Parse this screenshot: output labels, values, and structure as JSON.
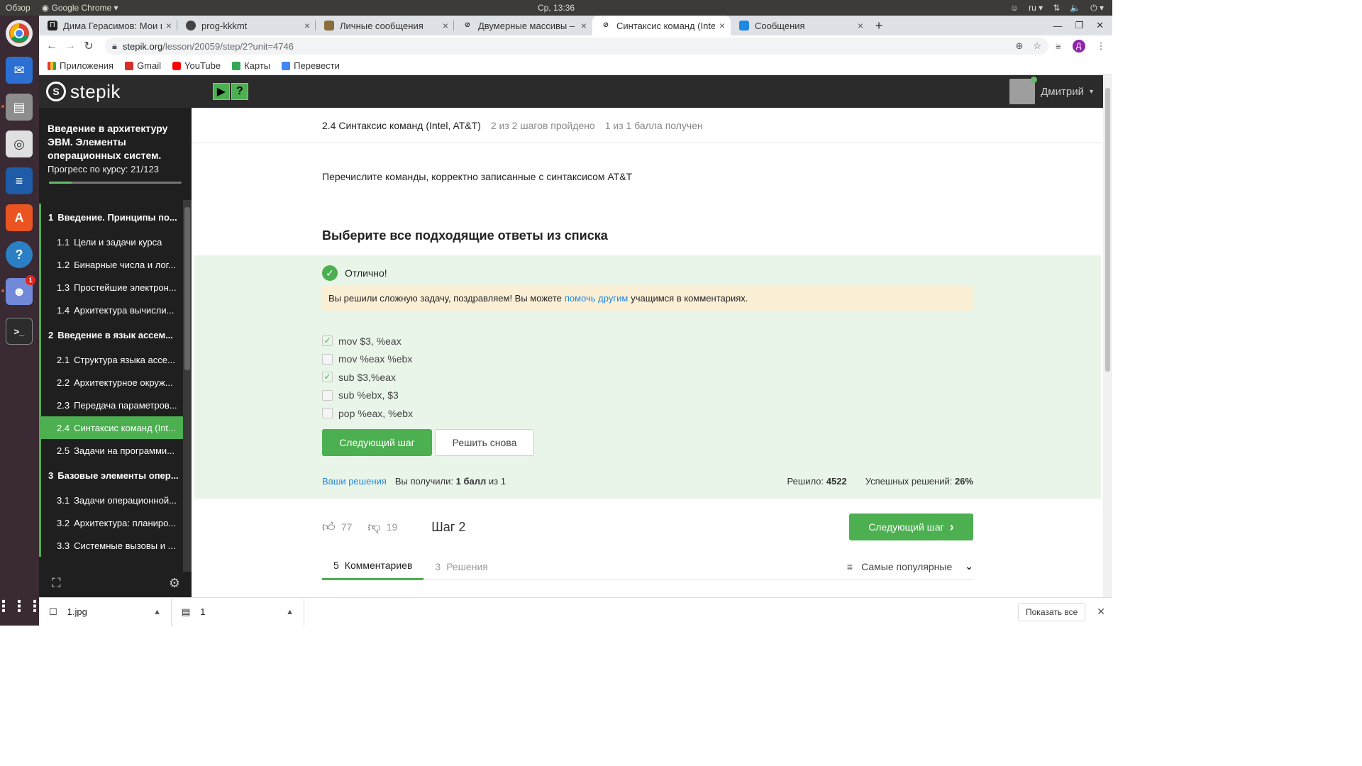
{
  "top_panel": {
    "activities": "Обзор",
    "app_name": "Google Chrome",
    "clock": "Ср, 13:36",
    "lang": "ru"
  },
  "tabs": [
    {
      "label": "Дима Герасимов: Мои пл",
      "active": false
    },
    {
      "label": "prog-kkkmt",
      "active": false
    },
    {
      "label": "Личные сообщения",
      "active": false
    },
    {
      "label": "Двумерные массивы – Ш",
      "active": false
    },
    {
      "label": "Синтаксис команд (Intel,",
      "active": true
    },
    {
      "label": "Сообщения",
      "active": false
    }
  ],
  "address": {
    "host": "stepik.org",
    "path": "/lesson/20059/step/2?unit=4746",
    "profile_letter": "Д"
  },
  "bookmarks": [
    "Приложения",
    "Gmail",
    "YouTube",
    "Карты",
    "Перевести"
  ],
  "stepik": {
    "logo": "stepik",
    "user_name": "Дмитрий"
  },
  "sidebar": {
    "course_title": "Введение в архитектуру ЭВМ. Элементы операционных систем.",
    "progress_label": "Прогресс по курсу:",
    "progress_value": "21/123",
    "progress_fraction": 0.17,
    "items": [
      {
        "num": "1",
        "label": "Введение. Принципы по...",
        "type": "section"
      },
      {
        "num": "1.1",
        "label": "Цели и задачи курса",
        "type": "lesson"
      },
      {
        "num": "1.2",
        "label": "Бинарные числа и лог...",
        "type": "lesson"
      },
      {
        "num": "1.3",
        "label": "Простейшие электрон...",
        "type": "lesson"
      },
      {
        "num": "1.4",
        "label": "Архитектура вычисли...",
        "type": "lesson"
      },
      {
        "num": "2",
        "label": "Введение в язык ассем...",
        "type": "section"
      },
      {
        "num": "2.1",
        "label": "Структура языка ассе...",
        "type": "lesson"
      },
      {
        "num": "2.2",
        "label": "Архитектурное окруж...",
        "type": "lesson"
      },
      {
        "num": "2.3",
        "label": "Передача параметров...",
        "type": "lesson"
      },
      {
        "num": "2.4",
        "label": "Синтаксис команд (Int...",
        "type": "lesson",
        "active": true
      },
      {
        "num": "2.5",
        "label": "Задачи на программи...",
        "type": "lesson"
      },
      {
        "num": "3",
        "label": "Базовые элементы опер...",
        "type": "section"
      },
      {
        "num": "3.1",
        "label": "Задачи операционной...",
        "type": "lesson"
      },
      {
        "num": "3.2",
        "label": "Архитектура: планиро...",
        "type": "lesson"
      },
      {
        "num": "3.3",
        "label": "Системные вызовы и ...",
        "type": "lesson"
      }
    ]
  },
  "lesson": {
    "title": "2.4 Синтаксис команд (Intel, AT&T)",
    "steps_done": "2 из 2 шагов пройдено",
    "points": "1 из 1 балла  получен",
    "task": "Перечислите команды, корректно записанные с синтаксисом AT&T",
    "choose_title": "Выберите все подходящие ответы из списка",
    "status": "Отлично!",
    "notice_before": "Вы решили сложную задачу, поздравляем! Вы можете",
    "notice_link": "помочь другим",
    "notice_after": "учащимся в комментариях.",
    "options": [
      {
        "text": "mov $3, %eax",
        "checked": true
      },
      {
        "text": "mov %eax %ebx",
        "checked": false
      },
      {
        "text": "sub $3,%eax",
        "checked": true
      },
      {
        "text": "sub %ebx, $3",
        "checked": false
      },
      {
        "text": "pop %eax, %ebx",
        "checked": false
      }
    ],
    "next_button": "Следующий шаг",
    "retry_button": "Решить снова",
    "your_solutions": "Ваши решения",
    "got_label": "Вы получили:",
    "got_value": "1 балл",
    "got_of": "из 1",
    "solved_label": "Решило:",
    "solved_value": "4522",
    "success_label": "Успешных решений:",
    "success_value": "26%",
    "likes": "77",
    "dislikes": "19",
    "step_label": "Шаг 2",
    "next_big": "Следующий шаг",
    "comments_count": "5",
    "comments_label": "Комментариев",
    "solutions_count": "3",
    "solutions_label": "Решения",
    "sort_label": "Самые популярные"
  },
  "downloads": {
    "items": [
      "1.jpg",
      "1"
    ],
    "show_all": "Показать все"
  }
}
